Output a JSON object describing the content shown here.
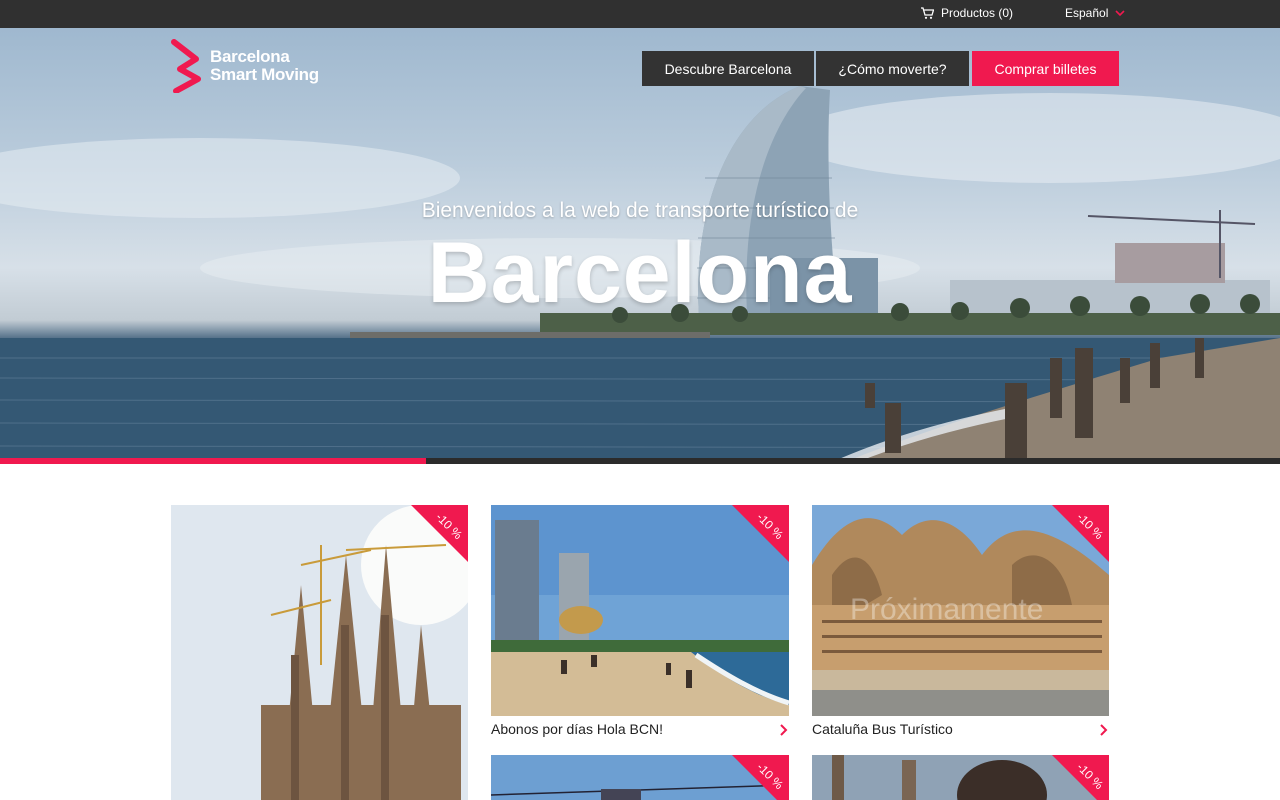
{
  "topbar": {
    "cart_label": "Productos (0)",
    "language": "Español",
    "icons": [
      "cart-icon",
      "chevron-down-icon"
    ]
  },
  "brand": {
    "name_line1": "Barcelona",
    "name_line2": "Smart Moving",
    "accent_color": "#f0194f",
    "dark_color": "#333333"
  },
  "nav": {
    "items": [
      {
        "label": "Descubre Barcelona"
      },
      {
        "label": "¿Cómo moverte?"
      },
      {
        "label": "Comprar billetes"
      }
    ]
  },
  "hero": {
    "subtitle": "Bienvenidos a la web de transporte turístico de",
    "title": "Barcelona",
    "slider_progress": 0.333
  },
  "products": [
    {
      "caption": "",
      "discount": "-10 %"
    },
    {
      "caption": "Abonos por días Hola BCN!",
      "discount": "-10 %"
    },
    {
      "caption": "Cataluña Bus Turístico",
      "discount": "-10 %",
      "overlay": "Próximamente"
    },
    {
      "caption": "",
      "discount": "-10 %"
    },
    {
      "caption": "",
      "discount": "-10 %"
    }
  ]
}
